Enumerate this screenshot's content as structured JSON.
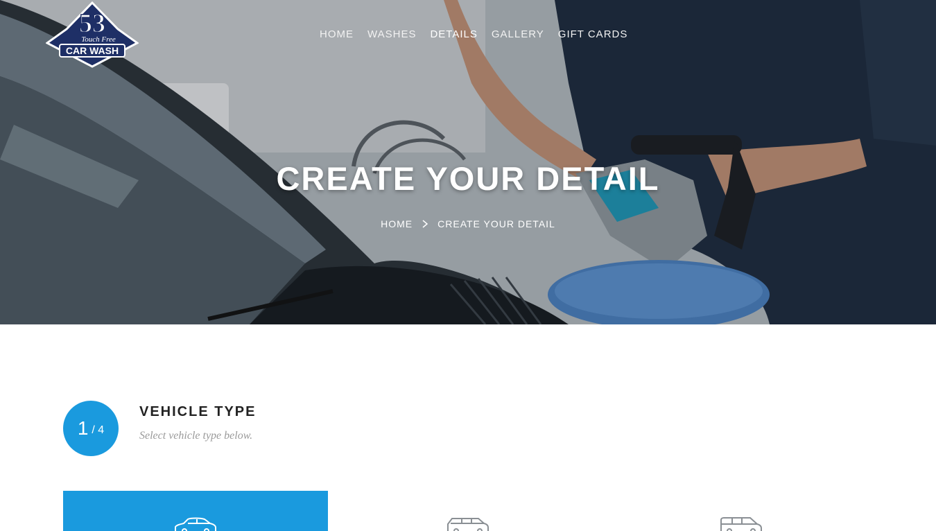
{
  "logo": {
    "number": "53",
    "tagline": "Touch Free",
    "name": "CAR WASH"
  },
  "nav": {
    "items": [
      {
        "label": "HOME",
        "active": false
      },
      {
        "label": "WASHES",
        "active": false
      },
      {
        "label": "DETAILS",
        "active": true
      },
      {
        "label": "GALLERY",
        "active": false
      },
      {
        "label": "GIFT CARDS",
        "active": false
      }
    ]
  },
  "hero": {
    "title": "CREATE YOUR DETAIL",
    "breadcrumb": {
      "home": "HOME",
      "current": "CREATE YOUR DETAIL"
    }
  },
  "step": {
    "current": "1",
    "total": "/ 4",
    "title": "VEHICLE TYPE",
    "subtitle": "Select vehicle type below."
  },
  "vehicles": [
    {
      "icon": "sedan-icon",
      "selected": true
    },
    {
      "icon": "suv-icon",
      "selected": false
    },
    {
      "icon": "van-icon",
      "selected": false
    }
  ],
  "colors": {
    "accent": "#1a9ade"
  }
}
